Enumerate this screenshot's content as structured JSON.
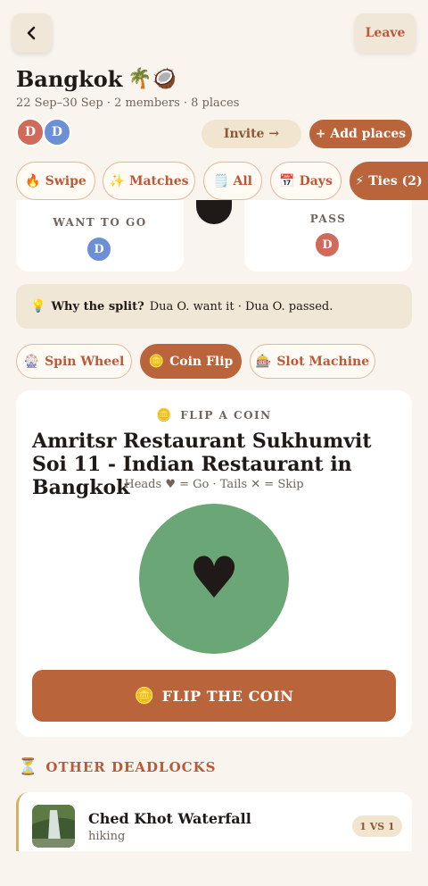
{
  "header": {
    "back_icon": "chevron-left-icon",
    "leave_label": "Leave"
  },
  "trip": {
    "title": "Bangkok",
    "title_emoji": "🌴🥥",
    "subtitle": "22 Sep–30 Sep · 2 members · 8 places",
    "members": [
      {
        "initial": "D",
        "color": "#d06a5b"
      },
      {
        "initial": "D",
        "color": "#6c8fd6"
      }
    ]
  },
  "actions": {
    "invite_label": "Invite →",
    "add_label": "+ Add places"
  },
  "tabs": [
    {
      "icon": "🔥",
      "label": "Swipe"
    },
    {
      "icon": "✨",
      "label": "Matches"
    },
    {
      "icon": "🗒️",
      "label": "All"
    },
    {
      "icon": "📅",
      "label": "Days"
    },
    {
      "icon": "⚡",
      "label": "Ties (2)"
    }
  ],
  "votes": {
    "want_label": "WANT TO GO",
    "want_initial": "D",
    "pass_label": "PASS",
    "pass_initial": "D"
  },
  "why": {
    "icon": "💡",
    "question": "Why the split?",
    "explanation": "Dua O. want it · Dua O. passed."
  },
  "modes": [
    {
      "icon": "🎡",
      "label": "Spin Wheel"
    },
    {
      "icon": "🪙",
      "label": "Coin Flip"
    },
    {
      "icon": "🎰",
      "label": "Slot Machine"
    }
  ],
  "coin": {
    "header_icon": "🪙",
    "header": "FLIP A COIN",
    "place": "Amritsr Restaurant Sukhumvit Soi 11 - Indian Restaurant in Bangkok",
    "rule": "Heads ♥ = Go · Tails ✕ = Skip",
    "face": "♥",
    "button_icon": "🪙",
    "button_label": "FLIP THE COIN",
    "color": "#6aa676"
  },
  "deadlocks": {
    "icon": "⏳",
    "heading": "OTHER DEADLOCKS",
    "items": [
      {
        "title": "Ched Khot Waterfall",
        "subtitle": "hiking",
        "badge": "1 VS 1"
      }
    ]
  },
  "colors": {
    "accent": "#b9643b",
    "background": "#f9f5ee",
    "card": "#ffffff"
  }
}
